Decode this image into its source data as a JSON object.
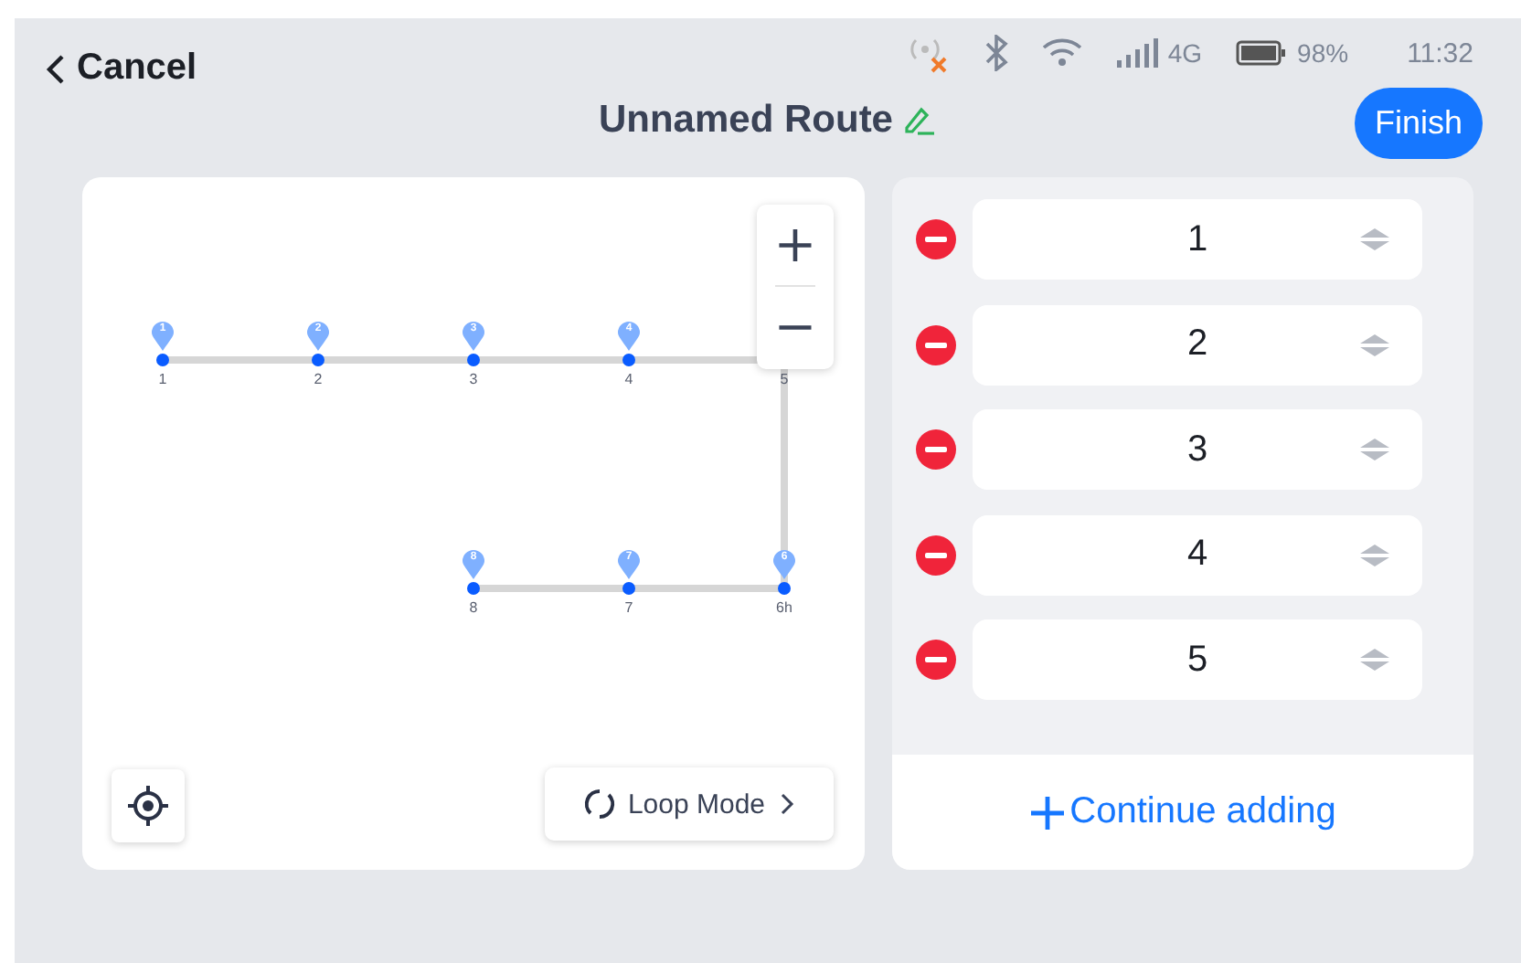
{
  "status_bar": {
    "network": "4G",
    "battery": "98%",
    "time": "11:32"
  },
  "header": {
    "cancel": "Cancel",
    "title": "Unnamed Route",
    "finish": "Finish"
  },
  "map": {
    "points": [
      {
        "label": "1",
        "pin": "1"
      },
      {
        "label": "2",
        "pin": "2"
      },
      {
        "label": "3",
        "pin": "3"
      },
      {
        "label": "4",
        "pin": "4"
      },
      {
        "label": "5"
      },
      {
        "label": "8",
        "pin": "8"
      },
      {
        "label": "7",
        "pin": "7"
      },
      {
        "label": "6h",
        "pin": "6"
      }
    ],
    "zoom_in": "+",
    "zoom_out": "−",
    "loop_mode": "Loop Mode"
  },
  "waypoints": [
    {
      "label": "1"
    },
    {
      "label": "2"
    },
    {
      "label": "3"
    },
    {
      "label": "4"
    },
    {
      "label": "5"
    }
  ],
  "continue_adding": "Continue adding"
}
